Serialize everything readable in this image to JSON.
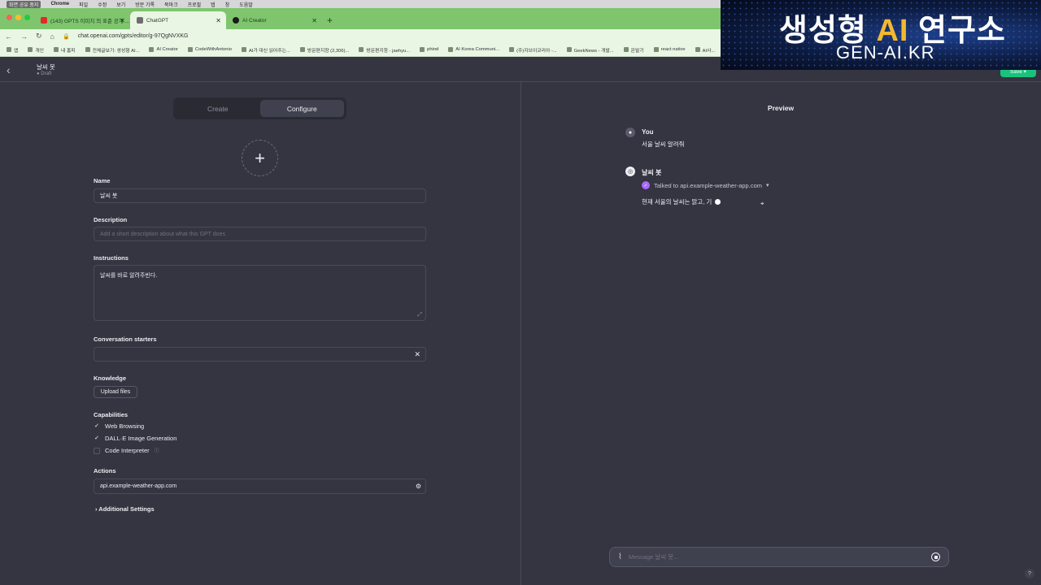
{
  "menubar": {
    "recording": "화면 공유 중지",
    "app": "Chrome",
    "items": [
      "파일",
      "수정",
      "보기",
      "방문 기록",
      "북마크",
      "프로필",
      "탭",
      "창",
      "도움말"
    ]
  },
  "browser": {
    "tabs": [
      {
        "label": "(143) GPTS 이미지 의 표준 공개 ...",
        "color": "#e02a2a"
      },
      {
        "label": "ChatGPT",
        "color": "#6e6e6e"
      },
      {
        "label": "AI Creator",
        "color": "#1a1a1a"
      }
    ],
    "url": "chat.openai.com/gpts/editor/g-97QgNVXKG",
    "bookmarks": [
      "앱",
      "개인",
      "내 홈피",
      "전체글보기: 생성형 AI...",
      "AI Creator",
      "CodeWithAntonio",
      "AI가 대신 읽어주는...",
      "방문편지함 (2,306)...",
      "방문편지함 - jaehyu...",
      "phind",
      "AI Korea Communi...",
      "(주)지브이코리아 -...",
      "GeekNews - 개발...",
      "온발기",
      "react native",
      "AI사..."
    ]
  },
  "overlay": {
    "title_a": "생성형 ",
    "title_ai": "AI",
    "title_b": " 연구소",
    "subtitle": "GEN-AI.KR"
  },
  "header": {
    "bot_name": "날씨 봇",
    "status": "● Draft",
    "save": "Save ▾"
  },
  "editor": {
    "tabs": {
      "create": "Create",
      "configure": "Configure"
    },
    "avatar_plus": "+",
    "name": {
      "label": "Name",
      "value": "날씨 봇"
    },
    "description": {
      "label": "Description",
      "placeholder": "Add a short description about what this GPT does"
    },
    "instructions": {
      "label": "Instructions",
      "value": "날씨를 바로 알려주빈다."
    },
    "starters": {
      "label": "Conversation starters",
      "value": "",
      "close": "✕"
    },
    "knowledge": {
      "label": "Knowledge",
      "upload": "Upload files"
    },
    "capabilities": {
      "label": "Capabilities",
      "items": [
        {
          "label": "Web Browsing",
          "checked": true
        },
        {
          "label": "DALL·E Image Generation",
          "checked": true
        },
        {
          "label": "Code Interpreter",
          "checked": false
        }
      ]
    },
    "actions": {
      "label": "Actions",
      "value": "api.example-weather-app.com"
    },
    "additional": "› Additional Settings"
  },
  "preview": {
    "title": "Preview",
    "user_name": "You",
    "user_msg": "서울 날씨 알려줘",
    "bot_name": "날씨 봇",
    "talked": "Talked to api.example-weather-app.com",
    "reply": "현재 서울의 날씨는 맑고, 기",
    "input_placeholder": "Message 날씨 봇..."
  },
  "help": "?"
}
